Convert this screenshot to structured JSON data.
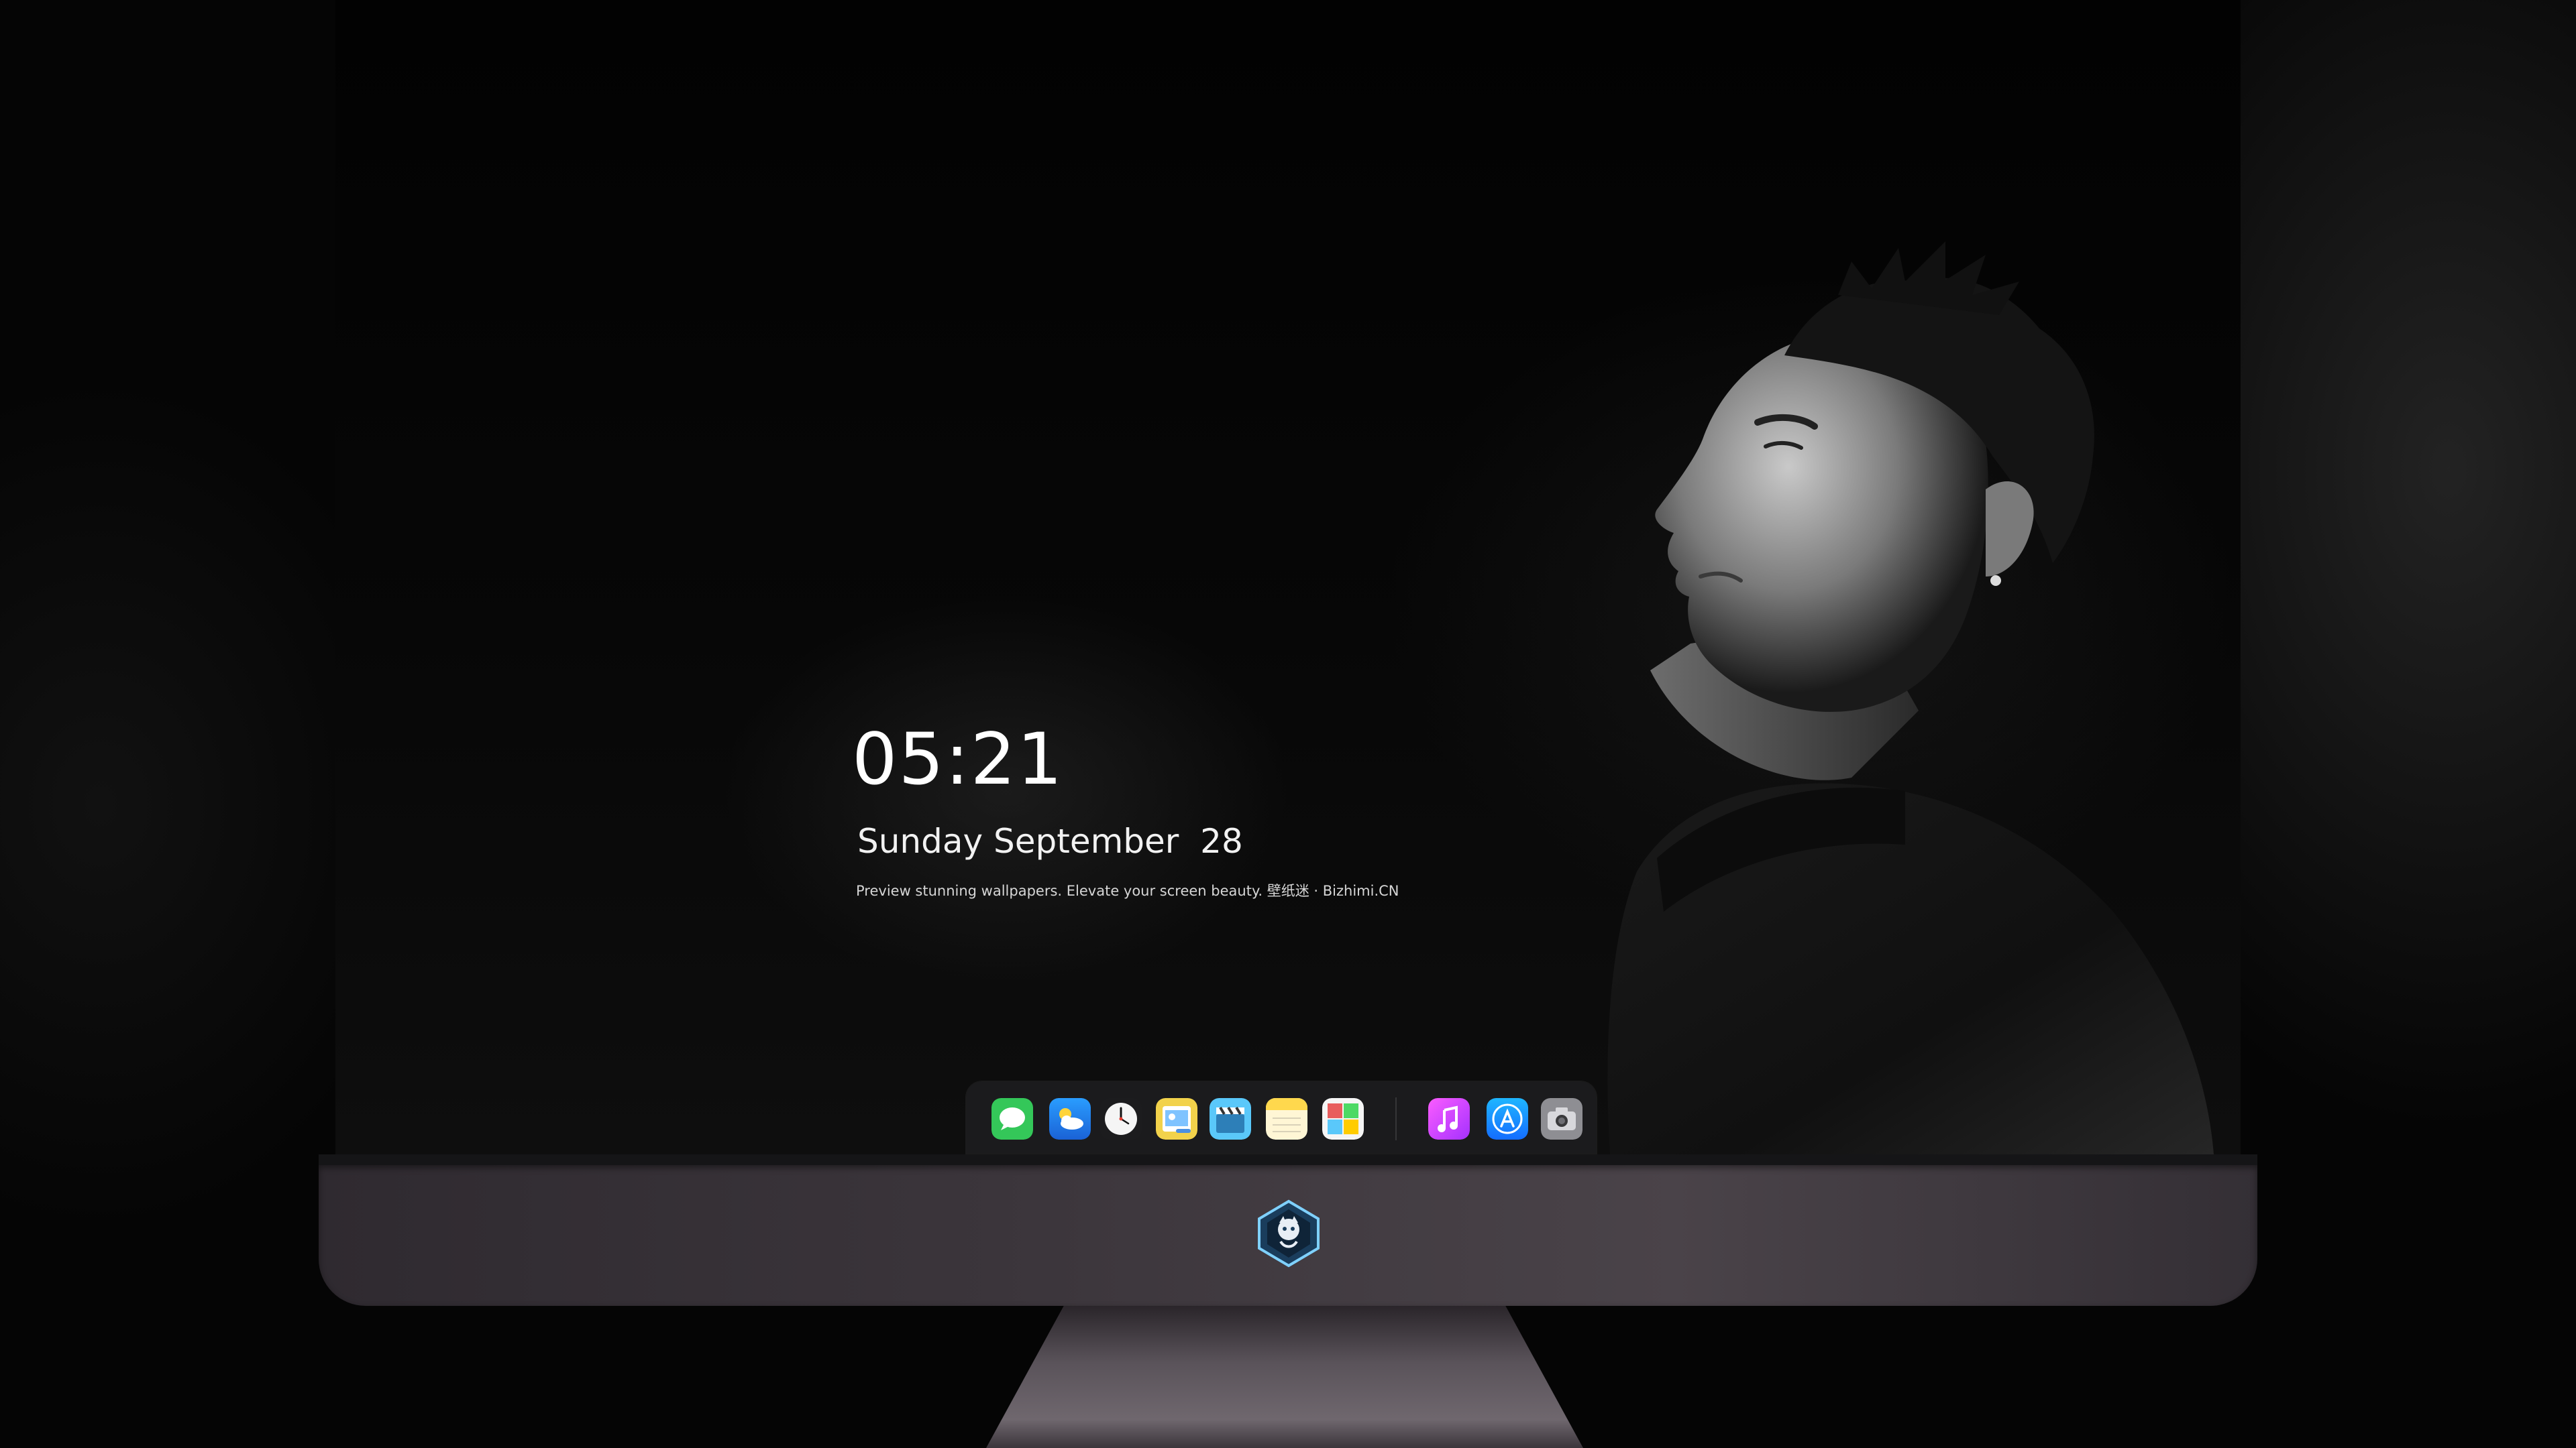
{
  "lockscreen": {
    "time": "05:21",
    "date": "Sunday September  28",
    "tagline": "Preview stunning wallpapers. Elevate your screen beauty. 壁纸迷 · Bizhimi.CN"
  },
  "dock": {
    "apps": [
      {
        "name": "Messages",
        "icon": "messages-icon",
        "color": "#34c759"
      },
      {
        "name": "Weather",
        "icon": "weather-icon",
        "color": "#2f8cff"
      },
      {
        "name": "Clock",
        "icon": "clock-icon",
        "color": "#1c1c1e"
      },
      {
        "name": "Preview",
        "icon": "preview-icon",
        "color": "#f2d24b"
      },
      {
        "name": "Clips",
        "icon": "clapperboard-icon",
        "color": "#5ac8fa"
      },
      {
        "name": "Notes",
        "icon": "notes-icon",
        "color": "#ffd84d"
      },
      {
        "name": "Photo Booth",
        "icon": "photo-grid-icon",
        "color": "#e85d5d"
      },
      {
        "name": "iTunes",
        "icon": "music-note-icon",
        "color": "#e94cff"
      },
      {
        "name": "App Store",
        "icon": "app-store-icon",
        "color": "#1a84ff"
      },
      {
        "name": "Screenshot",
        "icon": "camera-icon",
        "color": "#8e8e93"
      }
    ]
  },
  "colors": {
    "chin": "#3b353b",
    "stand": "#5a535a",
    "background": "#050505"
  }
}
